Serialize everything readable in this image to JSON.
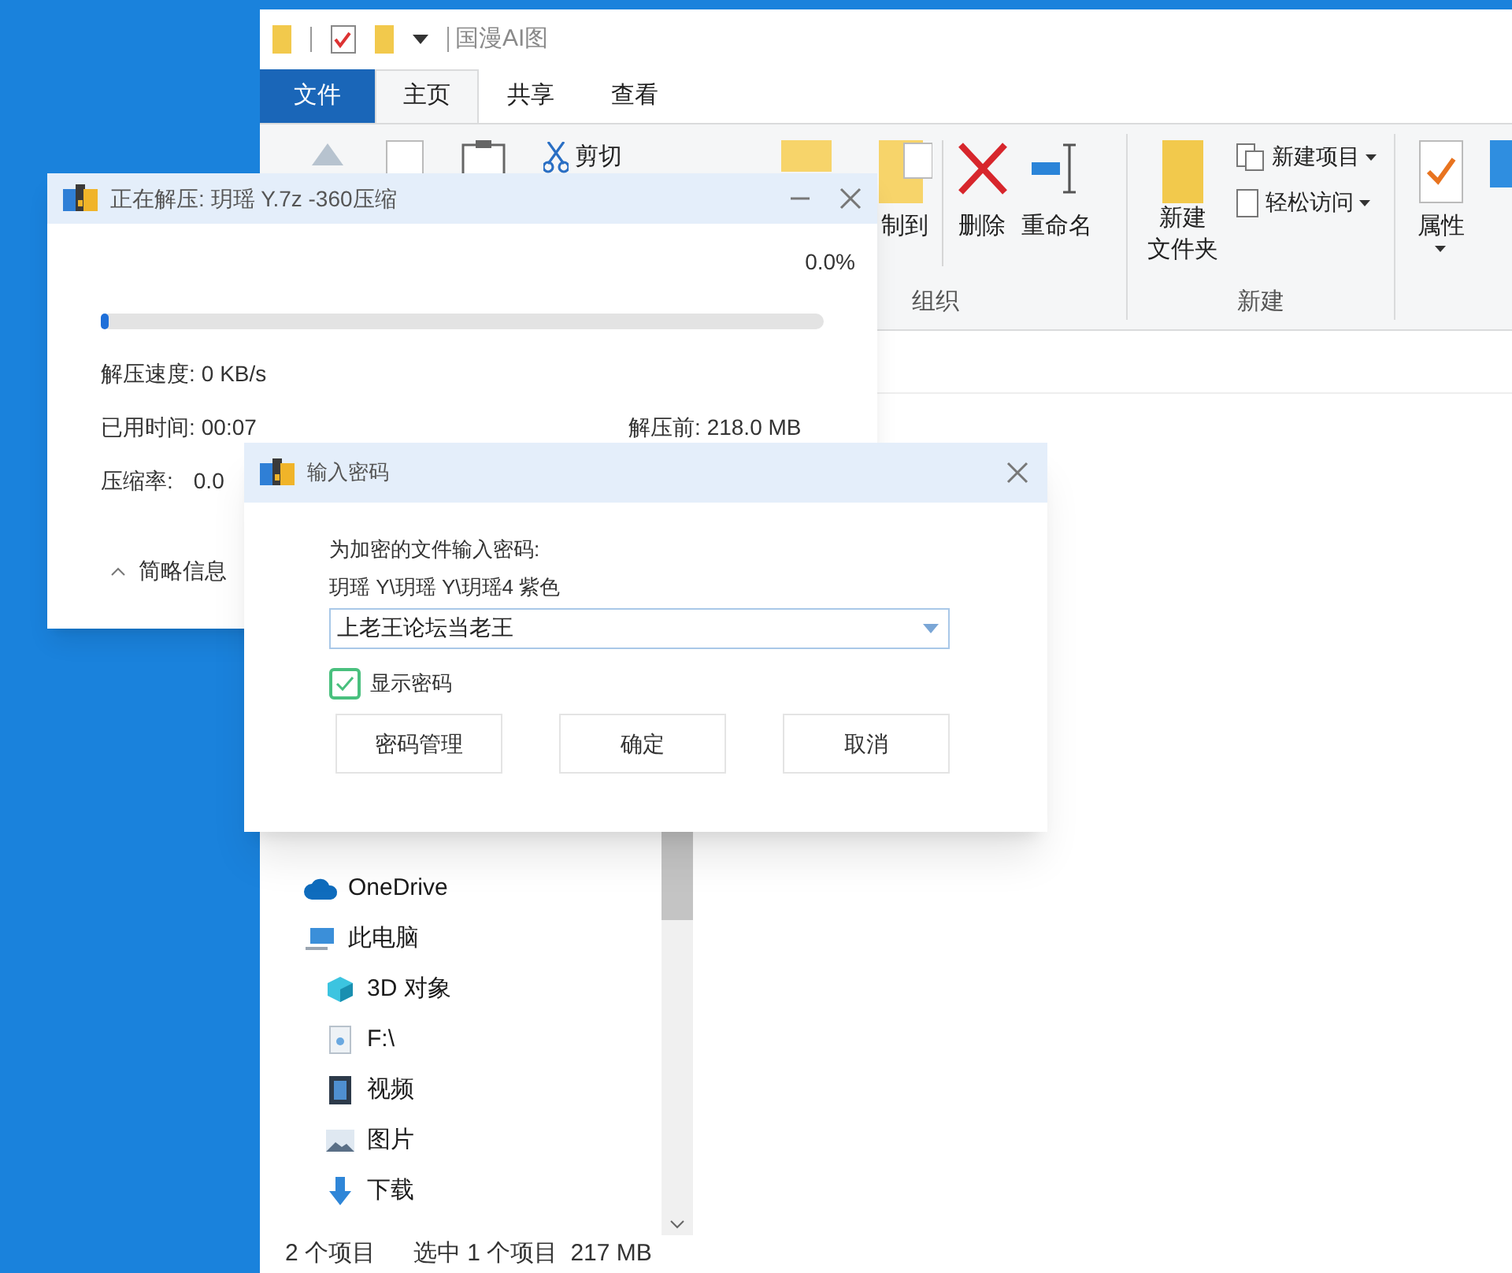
{
  "explorer": {
    "title": "国漫AI图",
    "tabs": [
      {
        "label": "文件",
        "kind": "file",
        "selected": false
      },
      {
        "label": "主页",
        "kind": "tab",
        "selected": true
      },
      {
        "label": "共享",
        "kind": "tab",
        "selected": false
      },
      {
        "label": "查看",
        "kind": "tab",
        "selected": false
      }
    ],
    "ribbon": {
      "cut": "剪切",
      "copy_to": "制到",
      "delete": "删除",
      "rename": "重命名",
      "new_folder": [
        "新建",
        "文件夹"
      ],
      "new_item": "新建项目",
      "easy_access": "轻松访问",
      "properties": "属性",
      "group_labels": [
        "组织",
        "新建"
      ]
    },
    "nav": [
      {
        "label": "OneDrive",
        "kind": "cloud"
      },
      {
        "label": "此电脑",
        "kind": "pc",
        "children": [
          {
            "label": "3D 对象",
            "kind": "cube"
          },
          {
            "label": "F:\\",
            "kind": "drive"
          },
          {
            "label": "视频",
            "kind": "video"
          },
          {
            "label": "图片",
            "kind": "image"
          },
          {
            "label": "下载",
            "kind": "download"
          }
        ]
      }
    ],
    "status": [
      "2 个项目",
      "选中 1 个项目",
      "217 MB"
    ]
  },
  "extract": {
    "title": "正在解压: 玥瑶 Y.7z -360压缩",
    "percent": "0.0%",
    "level": 0.01,
    "speed": {
      "label": "解压速度:",
      "value": "0 KB/s"
    },
    "elapsed": {
      "label": "已用时间:",
      "value": "00:07"
    },
    "before": {
      "label": "解压前:",
      "value": "218.0 MB"
    },
    "ratio": {
      "label": "压缩率:",
      "value": "0.0"
    },
    "details_toggle": "简略信息"
  },
  "password": {
    "title": "输入密码",
    "prompt": "为加密的文件输入密码:",
    "path": "玥瑶 Y\\玥瑶 Y\\玥瑶4 紫色",
    "value": "上老王论坛当老王",
    "show_password": {
      "label": "显示密码",
      "checked": true
    },
    "buttons": [
      "密码管理",
      "确定",
      "取消"
    ]
  }
}
